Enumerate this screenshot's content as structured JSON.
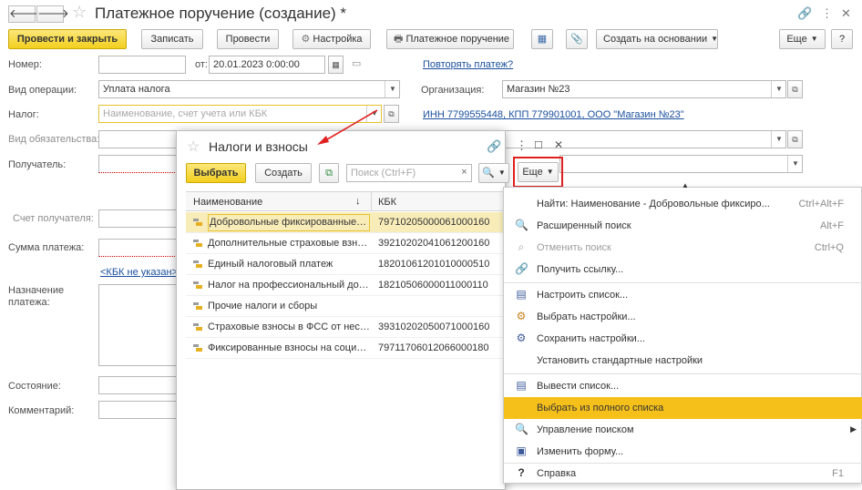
{
  "window": {
    "title": "Платежное поручение (создание) *",
    "back": "🡐",
    "forward": "🡒"
  },
  "toolbar": {
    "post_close": "Провести и закрыть",
    "save": "Записать",
    "post": "Провести",
    "settings": "Настройка",
    "print": "Платежное поручение",
    "create_based": "Создать на основании",
    "more": "Еще",
    "help": "?"
  },
  "form": {
    "number_label": "Номер:",
    "number_value": "",
    "from_label": "от:",
    "date_value": "20.01.2023  0:00:00",
    "repeat_link": "Повторять платеж?",
    "op_type_label": "Вид операции:",
    "op_type_value": "Уплата налога",
    "org_label": "Организация:",
    "org_value": "Магазин №23",
    "tax_label": "Налог:",
    "tax_placeholder": "Наименование, счет учета или КБК",
    "inn_link": "ИНН 7799555448, КПП 779901001, ООО \"Магазин №23\"",
    "obligation_label": "Вид обязательства:",
    "recipient_label": "Получатель:",
    "recipient_account_label": "Счет получателя:",
    "amount_label": "Сумма платежа:",
    "kbk_link": "<КБК не указан>",
    "purpose_label": "Назначение платежа:",
    "state_label": "Состояние:",
    "comment_label": "Комментарий:"
  },
  "dialog": {
    "title": "Налоги и взносы",
    "select": "Выбрать",
    "create": "Создать",
    "search_placeholder": "Поиск (Ctrl+F)",
    "search_clear": "×",
    "more": "Еще",
    "col_name": "Наименование",
    "col_sort": "↓",
    "col_kbk": "КБК",
    "rows": [
      {
        "name": "Добровольные фиксированные взносы",
        "kbk": "79710205000061000160"
      },
      {
        "name": "Дополнительные страховые взносы",
        "kbk": "39210202041061200160"
      },
      {
        "name": "Единый налоговый платеж",
        "kbk": "18201061201010000510"
      },
      {
        "name": "Налог на профессиональный доход",
        "kbk": "18210506000011000110"
      },
      {
        "name": "Прочие налоги и сборы",
        "kbk": ""
      },
      {
        "name": "Страховые взносы в ФСС от несчастных случаев",
        "kbk": "39310202050071000160"
      },
      {
        "name": "Фиксированные взносы на социальное страхование",
        "kbk": "79711706012066000180"
      }
    ]
  },
  "menu": {
    "items": [
      {
        "label": "Найти: Наименование - Добровольные фиксиро...",
        "shortcut": "Ctrl+Alt+F",
        "icon": ""
      },
      {
        "label": "Расширенный поиск",
        "shortcut": "Alt+F",
        "icon": "search-icon"
      },
      {
        "label": "Отменить поиск",
        "shortcut": "Ctrl+Q",
        "icon": "cancel-search-icon"
      },
      {
        "label": "Получить ссылку...",
        "shortcut": "",
        "icon": "link-icon"
      },
      {
        "label": "Настроить список...",
        "shortcut": "",
        "icon": "list-settings-icon"
      },
      {
        "label": "Выбрать настройки...",
        "shortcut": "",
        "icon": "load-settings-icon"
      },
      {
        "label": "Сохранить настройки...",
        "shortcut": "",
        "icon": "save-settings-icon"
      },
      {
        "label": "Установить стандартные настройки",
        "shortcut": "",
        "icon": ""
      },
      {
        "label": "Вывести список...",
        "shortcut": "",
        "icon": "output-list-icon"
      },
      {
        "label": "Выбрать из полного списка",
        "shortcut": "",
        "icon": ""
      },
      {
        "label": "Управление поиском",
        "shortcut": "",
        "icon": "search-icon"
      },
      {
        "label": "Изменить форму...",
        "shortcut": "",
        "icon": "form-icon"
      },
      {
        "label": "Справка",
        "shortcut": "F1",
        "icon": "help-icon"
      }
    ],
    "submenu_arrow": "▶"
  },
  "colors": {
    "accent_yellow": "#f3cf1e",
    "highlight": "#f6c01a",
    "callout_red": "#e02020",
    "link": "#1a4f9c"
  }
}
